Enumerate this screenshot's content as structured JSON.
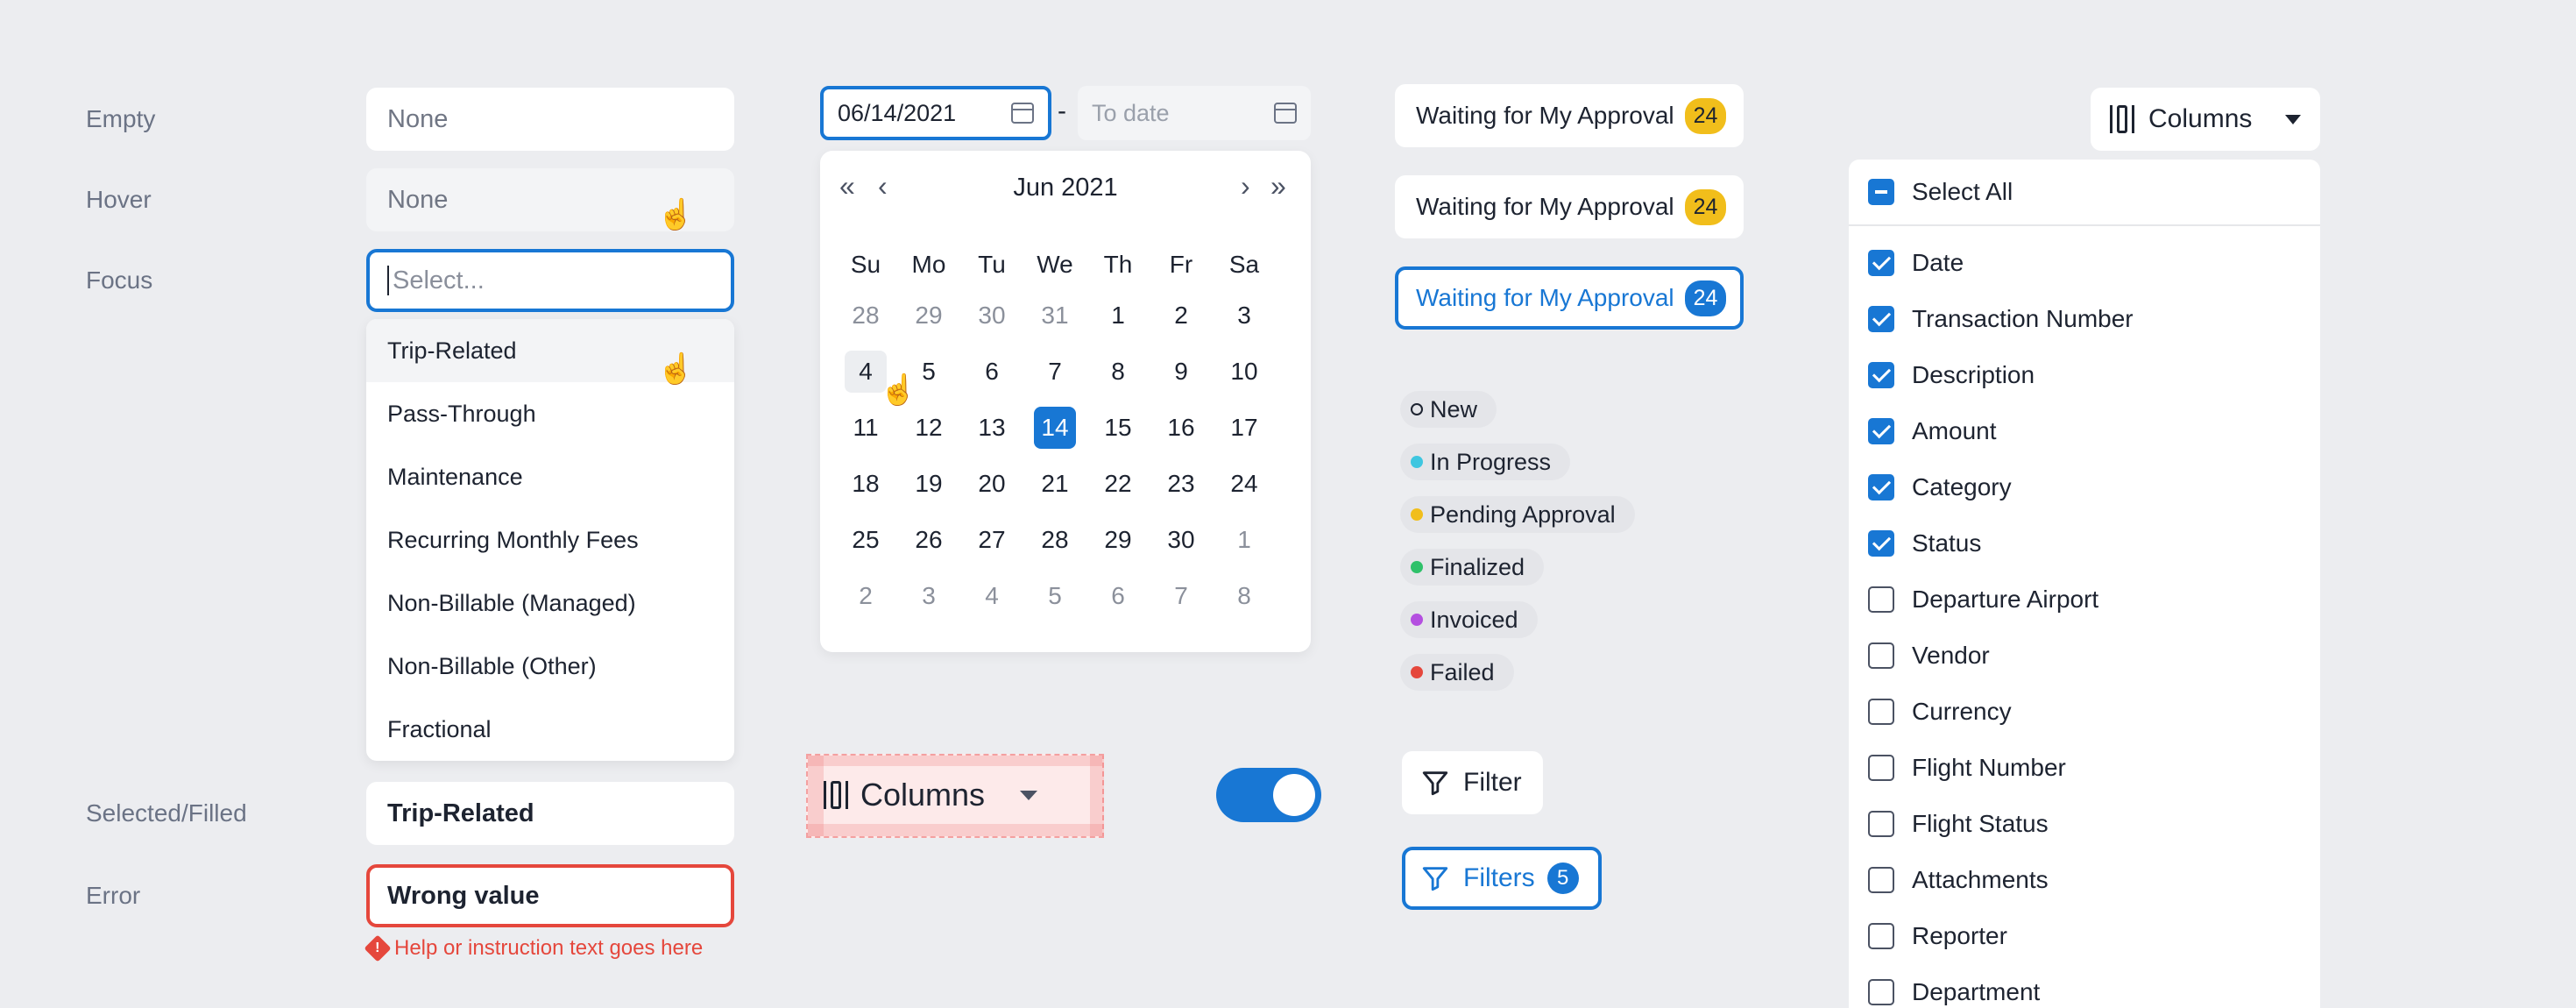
{
  "states": {
    "empty_label": "Empty",
    "hover_label": "Hover",
    "focus_label": "Focus",
    "filled_label": "Selected/Filled",
    "error_label": "Error",
    "empty_value": "None",
    "hover_value": "None",
    "focus_placeholder": "Select...",
    "filled_value": "Trip-Related",
    "error_value": "Wrong value",
    "error_help": "Help or instruction text goes here"
  },
  "dropdown": {
    "options": [
      "Trip-Related",
      "Pass-Through",
      "Maintenance",
      "Recurring Monthly Fees",
      "Non-Billable (Managed)",
      "Non-Billable (Other)",
      "Fractional"
    ]
  },
  "date_range": {
    "from": "06/14/2021",
    "separator": "-",
    "to_placeholder": "To date"
  },
  "calendar": {
    "month_label": "Jun 2021",
    "weekdays": [
      "Su",
      "Mo",
      "Tu",
      "We",
      "Th",
      "Fr",
      "Sa"
    ],
    "weeks": [
      [
        "28",
        "29",
        "30",
        "31",
        "1",
        "2",
        "3"
      ],
      [
        "4",
        "5",
        "6",
        "7",
        "8",
        "9",
        "10"
      ],
      [
        "11",
        "12",
        "13",
        "14",
        "15",
        "16",
        "17"
      ],
      [
        "18",
        "19",
        "20",
        "21",
        "22",
        "23",
        "24"
      ],
      [
        "25",
        "26",
        "27",
        "28",
        "29",
        "30",
        "1"
      ],
      [
        "2",
        "3",
        "4",
        "5",
        "6",
        "7",
        "8"
      ]
    ],
    "selected_day": "14",
    "hovered_day": "4"
  },
  "columns_spec_button": {
    "label": "Columns"
  },
  "toggle": {
    "on": true
  },
  "approvals": [
    {
      "label": "Waiting for My Approval",
      "count": "24"
    },
    {
      "label": "Waiting for My Approval",
      "count": "24"
    },
    {
      "label": "Waiting for My Approval",
      "count": "24"
    }
  ],
  "statuses": [
    {
      "label": "New",
      "color": ""
    },
    {
      "label": "In Progress",
      "color": "#3ec6e0"
    },
    {
      "label": "Pending Approval",
      "color": "#f1be1b"
    },
    {
      "label": "Finalized",
      "color": "#2fc16a"
    },
    {
      "label": "Invoiced",
      "color": "#b44fe0"
    },
    {
      "label": "Failed",
      "color": "#e5473c"
    }
  ],
  "filters": {
    "filter_label": "Filter",
    "filters_label": "Filters",
    "filters_count": "5"
  },
  "columns_picker": {
    "button_label": "Columns",
    "select_all_label": "Select All",
    "items": [
      {
        "label": "Date",
        "checked": true
      },
      {
        "label": "Transaction Number",
        "checked": true
      },
      {
        "label": "Description",
        "checked": true
      },
      {
        "label": "Amount",
        "checked": true
      },
      {
        "label": "Category",
        "checked": true
      },
      {
        "label": "Status",
        "checked": true
      },
      {
        "label": "Departure Airport",
        "checked": false
      },
      {
        "label": "Vendor",
        "checked": false
      },
      {
        "label": "Currency",
        "checked": false
      },
      {
        "label": "Flight Number",
        "checked": false
      },
      {
        "label": "Flight Status",
        "checked": false
      },
      {
        "label": "Attachments",
        "checked": false
      },
      {
        "label": "Reporter",
        "checked": false
      },
      {
        "label": "Department",
        "checked": false
      }
    ]
  },
  "colors": {
    "accent": "#1877d4",
    "error": "#e5473c",
    "badge": "#f1be1b",
    "background": "#ecedf0"
  }
}
